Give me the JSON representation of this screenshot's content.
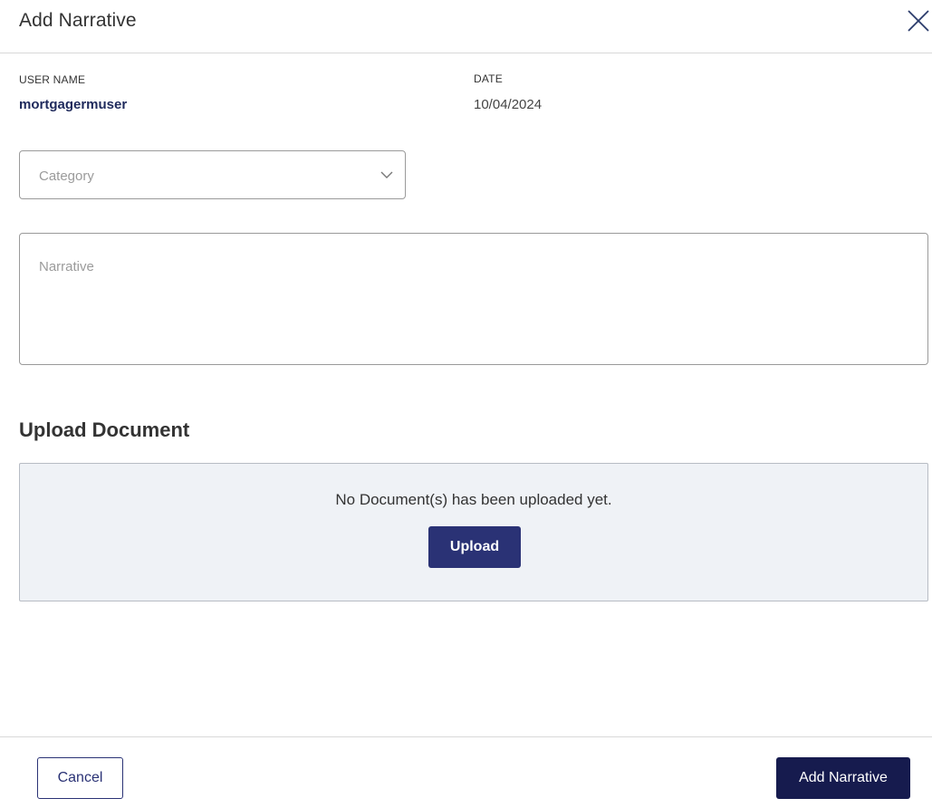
{
  "dialog": {
    "title": "Add Narrative",
    "close_icon": "close-icon"
  },
  "meta": {
    "user_name_label": "USER NAME",
    "user_name_value": "mortgagermuser",
    "date_label": "DATE",
    "date_value": "10/04/2024"
  },
  "form": {
    "category": {
      "placeholder": "Category",
      "selected": "",
      "icon": "chevron-down-icon"
    },
    "narrative": {
      "placeholder": "Narrative",
      "value": ""
    }
  },
  "upload": {
    "section_title": "Upload Document",
    "empty_message": "No Document(s) has been uploaded yet.",
    "button_label": "Upload"
  },
  "footer": {
    "cancel_label": "Cancel",
    "submit_label": "Add Narrative"
  },
  "colors": {
    "primary": "#2a3275",
    "primary_dark": "#161b4e",
    "link_text": "#1f2a5c",
    "upload_bg": "#eff2f6"
  }
}
